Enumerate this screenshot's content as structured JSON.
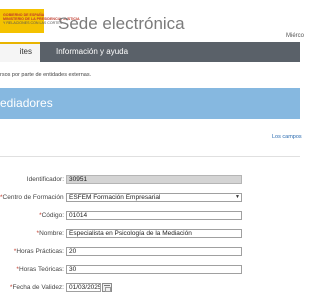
{
  "header": {
    "logo_lines": [
      "GOBIERNO DE ESPAÑA",
      "MINISTERIO DE LA PRESIDENCIA, JUSTICIA",
      "Y RELACIONES CON LAS CORTES"
    ],
    "site_title": "Sede electrónica",
    "user_text": "Miérco"
  },
  "nav": {
    "active_tab": "ites",
    "tab_info": "Información y ayuda"
  },
  "notice": "rsos por parte de entidades externas.",
  "banner": {
    "title": "ediadores"
  },
  "required_note": "Los campos",
  "form": {
    "identificador": {
      "label": "Identificador:",
      "value": "30951"
    },
    "centro": {
      "label": "Centro de Formación :",
      "value": "ESFEM Formación Empresarial"
    },
    "codigo": {
      "label": "Código:",
      "value": "01014"
    },
    "nombre": {
      "label": "Nombre:",
      "value": "Especialista en Psicología de la Mediación"
    },
    "horas_practicas": {
      "label": "Horas Prácticas:",
      "value": "20"
    },
    "horas_teoricas": {
      "label": "Horas Teóricas:",
      "value": "30"
    },
    "fecha_validez": {
      "label": "Fecha de Validez:",
      "value": "01/03/2025"
    },
    "required_marker": "*"
  },
  "colors": {
    "logo_yellow": "#f4c200",
    "nav_bg": "#5a6169",
    "banner_bg": "#86b8e0",
    "link_blue": "#2a6bb0",
    "required_red": "#c0392b"
  }
}
